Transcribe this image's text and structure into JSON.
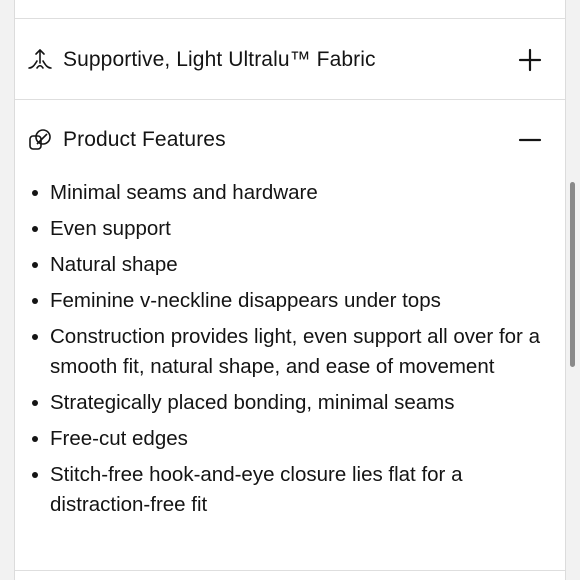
{
  "accordion": {
    "fabric": {
      "title": "Supportive, Light Ultralu™ Fabric",
      "icon": "stretch-fabric-icon",
      "state": "collapsed"
    },
    "features": {
      "title": "Product Features",
      "icon": "overlapping-shapes-icon",
      "state": "expanded",
      "items": [
        "Minimal seams and hardware",
        "Even support",
        "Natural shape",
        "Feminine v-neckline disappears under tops",
        "Construction provides light, even support all over for a smooth fit, natural shape, and ease of movement",
        "Strategically placed bonding, minimal seams",
        "Free-cut edges",
        "Stitch-free hook-and-eye closure lies flat for a distraction-free fit"
      ]
    }
  },
  "colors": {
    "text": "#141414",
    "divider": "#dedede",
    "background": "#ffffff"
  }
}
